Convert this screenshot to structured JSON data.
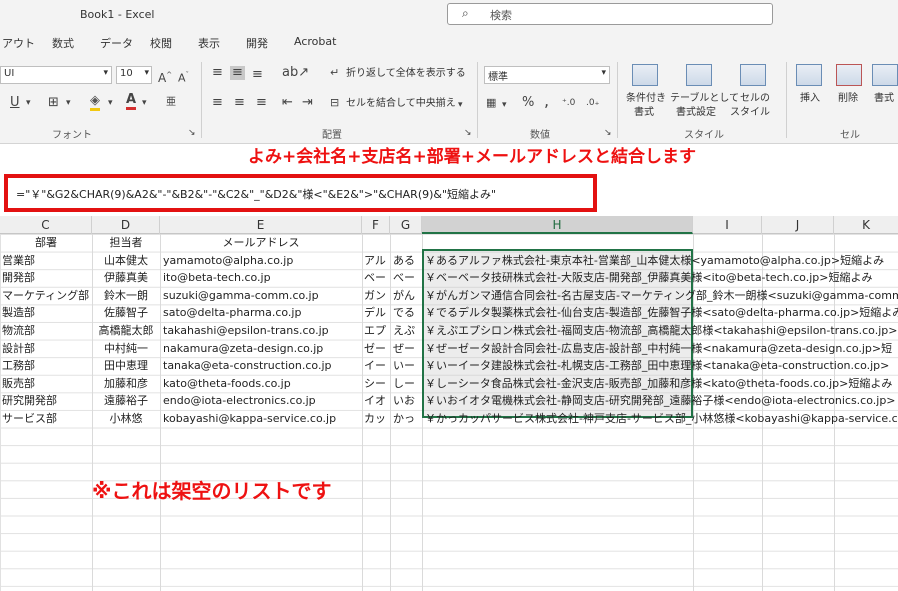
{
  "window": {
    "title": "Book1 - Excel",
    "search_placeholder": "検索"
  },
  "menu_tabs": [
    "アウト",
    "数式",
    "データ",
    "校閲",
    "表示",
    "開発",
    "Acrobat"
  ],
  "ribbon": {
    "font_name": "UI",
    "font_size": "10",
    "font_group": "フォント",
    "align_group": "配置",
    "wrap_text": "折り返して全体を表示する",
    "merge_center": "セルを結合して中央揃え",
    "number_format": "標準",
    "number_group": "数値",
    "cond_format": [
      "条件付き",
      "書式"
    ],
    "table_format": [
      "テーブルとして",
      "書式設定"
    ],
    "cell_style": [
      "セルの",
      "スタイル"
    ],
    "style_group": "スタイル",
    "insert": "挿入",
    "delete": "削除",
    "format": "書式",
    "cells_group": "セル"
  },
  "annotation_top": "よみ+会社名+支店名+部署+メールアドレスと結合します",
  "formula": "=\"￥\"&G2&CHAR(9)&A2&\"-\"&B2&\"-\"&C2&\"_\"&D2&\"様<\"&E2&\">\"&CHAR(9)&\"短縮よみ\"",
  "columns": [
    "C",
    "D",
    "E",
    "F",
    "G",
    "H",
    "I",
    "J",
    "K"
  ],
  "headers": {
    "c": "部署",
    "d": "担当者",
    "e": "メールアドレス"
  },
  "rows": [
    {
      "c": "営業部",
      "d": "山本健太",
      "e": "yamamoto@alpha.co.jp",
      "f": "アル",
      "g": "ある",
      "h": "￥あるアルファ株式会社-東京本社-営業部_山本健太様<yamamoto@alpha.co.jp>短縮よみ"
    },
    {
      "c": "開発部",
      "d": "伊藤真美",
      "e": "ito@beta-tech.co.jp",
      "f": "ベー",
      "g": "べー",
      "h": "￥ベーベータ技研株式会社-大阪支店-開発部_伊藤真美様<ito@beta-tech.co.jp>短縮よみ"
    },
    {
      "c": "マーケティング部",
      "d": "鈴木一朗",
      "e": "suzuki@gamma-comm.co.jp",
      "f": "ガン",
      "g": "がん",
      "h": "￥がんガンマ通信合同会社-名古屋支店-マーケティング部_鈴木一朗様<suzuki@gamma-comm.co.jp>"
    },
    {
      "c": "製造部",
      "d": "佐藤智子",
      "e": "sato@delta-pharma.co.jp",
      "f": "デル",
      "g": "でる",
      "h": "￥でるデルタ製薬株式会社-仙台支店-製造部_佐藤智子様<sato@delta-pharma.co.jp>短縮よみ"
    },
    {
      "c": "物流部",
      "d": "高橋龍太郎",
      "e": "takahashi@epsilon-trans.co.jp",
      "f": "エプ",
      "g": "えぷ",
      "h": "￥えぷエプシロン株式会社-福岡支店-物流部_高橋龍太郎様<takahashi@epsilon-trans.co.jp>"
    },
    {
      "c": "設計部",
      "d": "中村純一",
      "e": "nakamura@zeta-design.co.jp",
      "f": "ゼー",
      "g": "ぜー",
      "h": "￥ぜーゼータ設計合同会社-広島支店-設計部_中村純一様<nakamura@zeta-design.co.jp>短"
    },
    {
      "c": "工務部",
      "d": "田中恵理",
      "e": "tanaka@eta-construction.co.jp",
      "f": "イー",
      "g": "いー",
      "h": "￥いーイータ建設株式会社-札幌支店-工務部_田中恵理様<tanaka@eta-construction.co.jp>"
    },
    {
      "c": "販売部",
      "d": "加藤和彦",
      "e": "kato@theta-foods.co.jp",
      "f": "シー",
      "g": "しー",
      "h": "￥しーシータ食品株式会社-金沢支店-販売部_加藤和彦様<kato@theta-foods.co.jp>短縮よみ"
    },
    {
      "c": "研究開発部",
      "d": "遠藤裕子",
      "e": "endo@iota-electronics.co.jp",
      "f": "イオ",
      "g": "いお",
      "h": "￥いおイオタ電機株式会社-静岡支店-研究開発部_遠藤裕子様<endo@iota-electronics.co.jp>"
    },
    {
      "c": "サービス部",
      "d": "小林悠",
      "e": "kobayashi@kappa-service.co.jp",
      "f": "カッ",
      "g": "かっ",
      "h": "￥かっカッパサービス株式会社-神戸支店-サービス部_小林悠様<kobayashi@kappa-service.co.jp>"
    }
  ],
  "annotation_bottom": "※これは架空のリストです"
}
